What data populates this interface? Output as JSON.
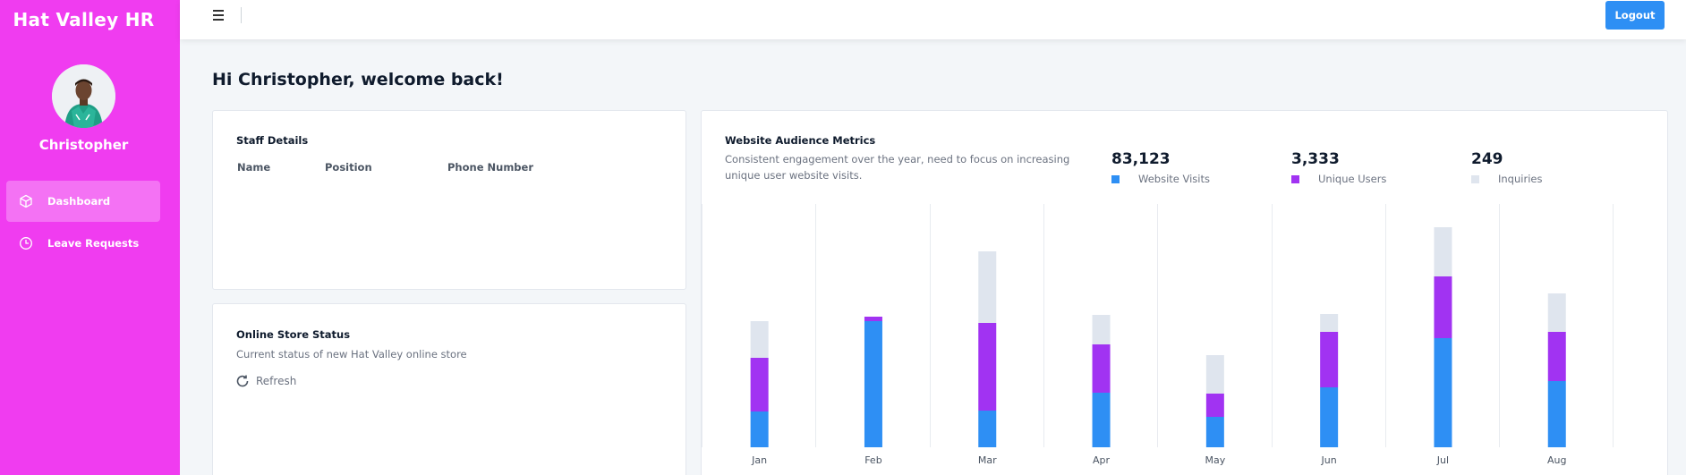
{
  "app": {
    "title": "Hat Valley HR"
  },
  "user": {
    "name": "Christopher"
  },
  "sidebar": {
    "items": [
      {
        "label": "Dashboard",
        "icon": "cube-icon",
        "active": true
      },
      {
        "label": "Leave Requests",
        "icon": "clock-icon",
        "active": false
      }
    ]
  },
  "topbar": {
    "logout_label": "Logout",
    "menu_icon": "hamburger-icon"
  },
  "welcome": "Hi Christopher, welcome back!",
  "staff": {
    "title": "Staff Details",
    "columns": [
      "Name",
      "Position",
      "Phone Number"
    ],
    "rows": []
  },
  "store": {
    "title": "Online Store Status",
    "subtitle": "Current status of new Hat Valley online store",
    "refresh_label": "Refresh"
  },
  "audience": {
    "title": "Website Audience Metrics",
    "description_line1": "Consistent engagement over the year, need to focus on increasing",
    "description_line2": "unique user website visits.",
    "stats": [
      {
        "value": "83,123",
        "label": "Website Visits",
        "color": "#2e8ff4"
      },
      {
        "value": "3,333",
        "label": "Unique Users",
        "color": "#a133f2"
      },
      {
        "value": "249",
        "label": "Inquiries",
        "color": "#dfe5ee"
      }
    ]
  },
  "colors": {
    "sidebar": "#f03cf0",
    "accent": "#2e8ff4"
  },
  "chart_data": {
    "type": "bar",
    "stacked": true,
    "categories": [
      "Jan",
      "Feb",
      "Mar",
      "Apr",
      "May",
      "Jun",
      "Jul",
      "Aug"
    ],
    "series": [
      {
        "name": "Website Visits",
        "color": "#2e8ff4",
        "values": [
          40,
          141,
          41,
          61,
          34,
          67,
          122,
          74
        ]
      },
      {
        "name": "Unique Users",
        "color": "#a133f2",
        "values": [
          60,
          5,
          98,
          54,
          26,
          62,
          69,
          55
        ]
      },
      {
        "name": "Inquiries",
        "color": "#dfe5ee",
        "values": [
          41,
          0,
          80,
          33,
          43,
          20,
          55,
          43
        ]
      }
    ],
    "ylim": [
      0,
      280
    ],
    "grid": "vertical",
    "legend": "none"
  }
}
